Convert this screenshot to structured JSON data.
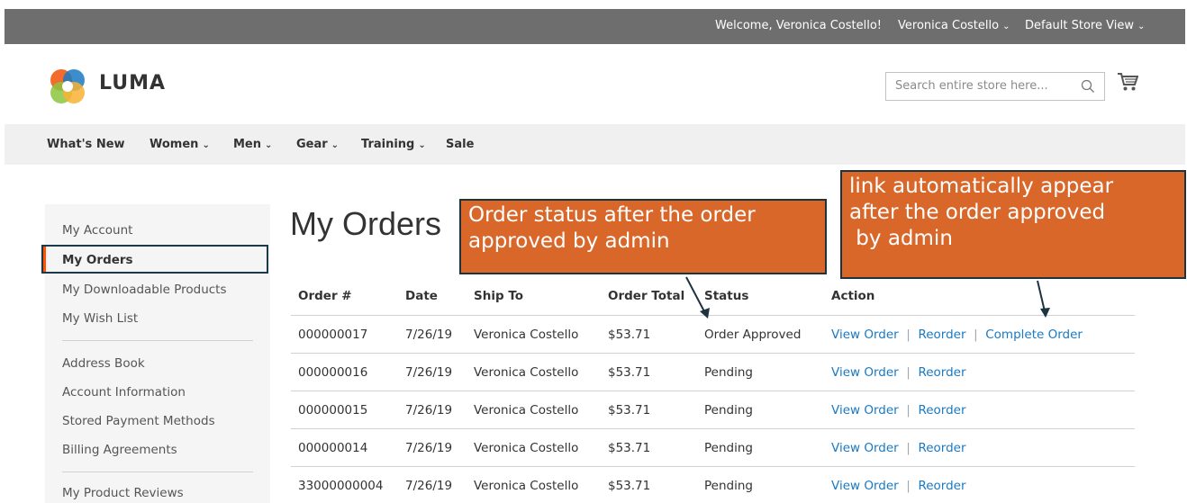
{
  "header": {
    "welcome": "Welcome, Veronica Costello!",
    "account_name": "Veronica Costello",
    "store_view": "Default Store View"
  },
  "logo": {
    "text": "LUMA"
  },
  "search": {
    "placeholder": "Search entire store here..."
  },
  "nav": [
    "What's New",
    "Women",
    "Men",
    "Gear",
    "Training",
    "Sale"
  ],
  "sidebar": {
    "items": [
      "My Account",
      "My Orders",
      "My Downloadable Products",
      "My Wish List",
      "Address Book",
      "Account Information",
      "Stored Payment Methods",
      "Billing Agreements",
      "My Product Reviews"
    ]
  },
  "page_title": "My Orders",
  "table": {
    "columns": [
      "Order #",
      "Date",
      "Ship To",
      "Order Total",
      "Status",
      "Action"
    ],
    "rows": [
      {
        "order": "000000017",
        "date": "7/26/19",
        "ship_to": "Veronica Costello",
        "total": "$53.71",
        "status": "Order Approved",
        "actions": [
          "View Order",
          "Reorder",
          "Complete Order"
        ]
      },
      {
        "order": "000000016",
        "date": "7/26/19",
        "ship_to": "Veronica Costello",
        "total": "$53.71",
        "status": "Pending",
        "actions": [
          "View Order",
          "Reorder"
        ]
      },
      {
        "order": "000000015",
        "date": "7/26/19",
        "ship_to": "Veronica Costello",
        "total": "$53.71",
        "status": "Pending",
        "actions": [
          "View Order",
          "Reorder"
        ]
      },
      {
        "order": "000000014",
        "date": "7/26/19",
        "ship_to": "Veronica Costello",
        "total": "$53.71",
        "status": "Pending",
        "actions": [
          "View Order",
          "Reorder"
        ]
      },
      {
        "order": "33000000004",
        "date": "7/26/19",
        "ship_to": "Veronica Costello",
        "total": "$53.71",
        "status": "Pending",
        "actions": [
          "View Order",
          "Reorder"
        ]
      }
    ]
  },
  "annotations": {
    "status_note_line1": "Order status after the order",
    "status_note_line2": "approved by admin",
    "link_note_line1": "link automatically appear",
    "link_note_line2": "after the order approved",
    "link_note_line3": " by admin"
  },
  "colors": {
    "topbar": "#6e6e6e",
    "link": "#1979c3",
    "callout": "#d9672a",
    "active_accent": "#ff5501"
  }
}
